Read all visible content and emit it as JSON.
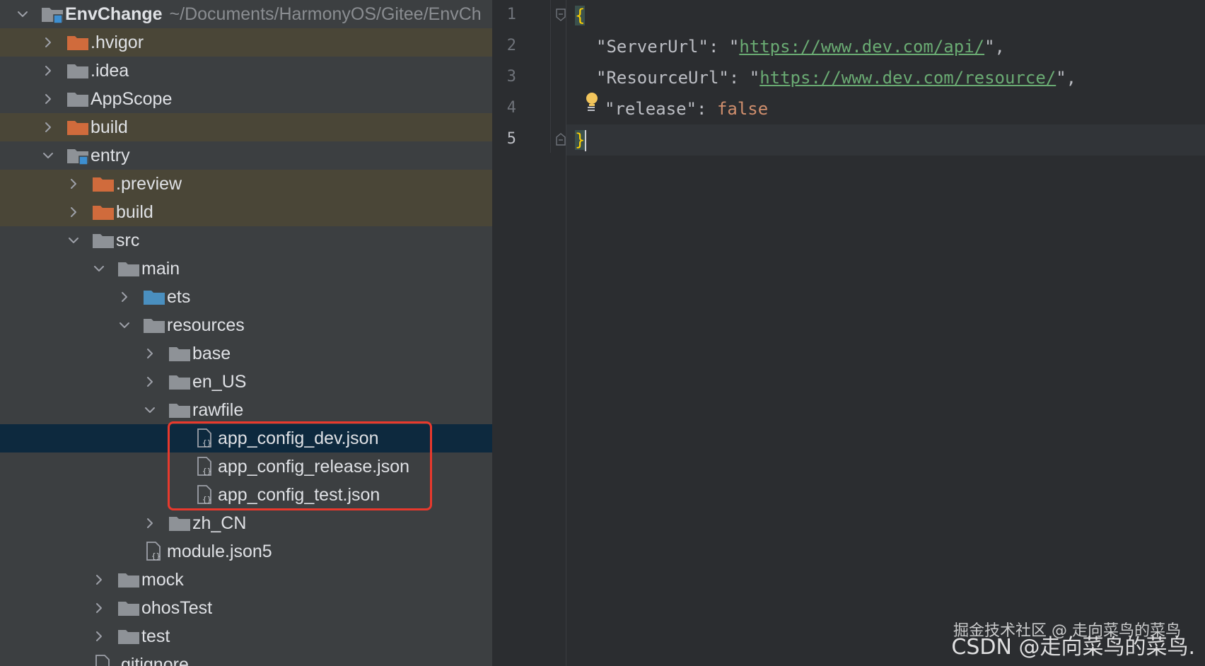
{
  "project_tree": {
    "root": {
      "label": "EnvChange",
      "path": "~/Documents/HarmonyOS/Gitee/EnvCh"
    },
    "items": [
      {
        "label": ".hvigor",
        "depth": 1,
        "expanded": false,
        "kind": "folder-excluded"
      },
      {
        "label": ".idea",
        "depth": 1,
        "expanded": false,
        "kind": "folder"
      },
      {
        "label": "AppScope",
        "depth": 1,
        "expanded": false,
        "kind": "folder"
      },
      {
        "label": "build",
        "depth": 1,
        "expanded": false,
        "kind": "folder-excluded"
      },
      {
        "label": "entry",
        "depth": 1,
        "expanded": true,
        "kind": "module"
      },
      {
        "label": ".preview",
        "depth": 2,
        "expanded": false,
        "kind": "folder-excluded"
      },
      {
        "label": "build",
        "depth": 2,
        "expanded": false,
        "kind": "folder-excluded"
      },
      {
        "label": "src",
        "depth": 2,
        "expanded": true,
        "kind": "folder"
      },
      {
        "label": "main",
        "depth": 3,
        "expanded": true,
        "kind": "folder"
      },
      {
        "label": "ets",
        "depth": 4,
        "expanded": false,
        "kind": "folder-source"
      },
      {
        "label": "resources",
        "depth": 4,
        "expanded": true,
        "kind": "folder"
      },
      {
        "label": "base",
        "depth": 5,
        "expanded": false,
        "kind": "folder"
      },
      {
        "label": "en_US",
        "depth": 5,
        "expanded": false,
        "kind": "folder"
      },
      {
        "label": "rawfile",
        "depth": 5,
        "expanded": true,
        "kind": "folder"
      },
      {
        "label": "app_config_dev.json",
        "depth": 6,
        "kind": "json",
        "selected": true
      },
      {
        "label": "app_config_release.json",
        "depth": 6,
        "kind": "json"
      },
      {
        "label": "app_config_test.json",
        "depth": 6,
        "kind": "json"
      },
      {
        "label": "zh_CN",
        "depth": 5,
        "expanded": false,
        "kind": "folder"
      },
      {
        "label": "module.json5",
        "depth": 4,
        "kind": "json"
      },
      {
        "label": "mock",
        "depth": 3,
        "expanded": false,
        "kind": "folder"
      },
      {
        "label": "ohosTest",
        "depth": 3,
        "expanded": false,
        "kind": "folder"
      },
      {
        "label": "test",
        "depth": 3,
        "expanded": false,
        "kind": "folder"
      },
      {
        "label": ".gitignore",
        "depth": 2,
        "kind": "file"
      }
    ]
  },
  "editor": {
    "line_numbers": [
      "1",
      "2",
      "3",
      "4",
      "5"
    ],
    "lines": {
      "l1_open": "{",
      "l2_key": "\"ServerUrl\"",
      "l2_sep": ": \"",
      "l2_url": "https://www.dev.com/api/",
      "l2_end": "\",",
      "l3_key": "\"ResourceUrl\"",
      "l3_sep": ": \"",
      "l3_url": "https://www.dev.com/resource/",
      "l3_end": "\",",
      "l4_key": "\"release\"",
      "l4_sep": ": ",
      "l4_val": "false",
      "l5_close": "}"
    }
  },
  "watermark": {
    "text": "CSDN @走向菜鸟的菜鸟.",
    "text2": "掘金技术社区 @ 走向菜鸟的菜鸟"
  },
  "colors": {
    "highlight_box": "#e8392d",
    "selected_row": "#0d293e",
    "excluded_row": "#4a4637"
  }
}
